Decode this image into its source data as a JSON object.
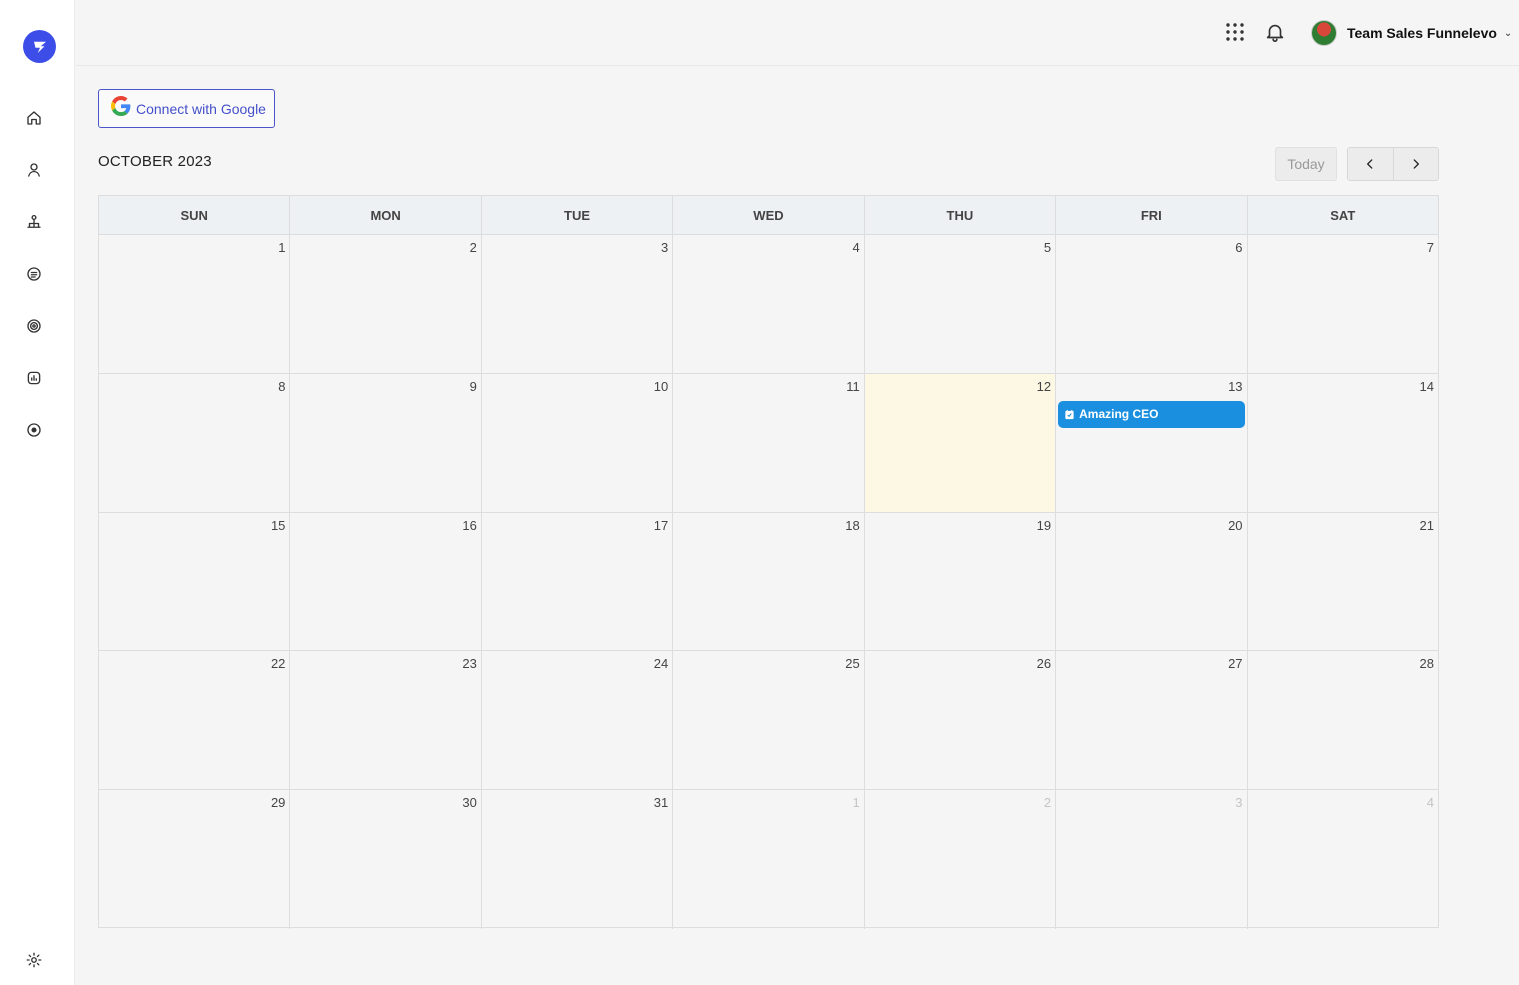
{
  "sidebar": {
    "items": [
      {
        "name": "home-icon"
      },
      {
        "name": "user-icon"
      },
      {
        "name": "org-chart-icon"
      },
      {
        "name": "document-icon"
      },
      {
        "name": "target-icon"
      },
      {
        "name": "report-chart-icon"
      },
      {
        "name": "play-circle-icon"
      }
    ],
    "settings_icon": "gear-icon"
  },
  "topbar": {
    "user_name": "Team Sales Funnelevo",
    "chevron": "⌄"
  },
  "connect": {
    "label": "Connect with Google"
  },
  "calendar": {
    "month_title": "OCTOBER 2023",
    "today_label": "Today",
    "weekdays": [
      "SUN",
      "MON",
      "TUE",
      "WED",
      "THU",
      "FRI",
      "SAT"
    ],
    "weeks": [
      [
        "1",
        "2",
        "3",
        "4",
        "5",
        "6",
        "7"
      ],
      [
        "8",
        "9",
        "10",
        "11",
        "12",
        "13",
        "14"
      ],
      [
        "15",
        "16",
        "17",
        "18",
        "19",
        "20",
        "21"
      ],
      [
        "22",
        "23",
        "24",
        "25",
        "26",
        "27",
        "28"
      ],
      [
        "29",
        "30",
        "31",
        "1",
        "2",
        "3",
        "4"
      ]
    ],
    "today_date": "12",
    "events": [
      {
        "date": "13",
        "title": "Amazing CEO",
        "color": "#1a8fe0"
      }
    ]
  },
  "colors": {
    "accent": "#3d4ee8",
    "event": "#1a8fe0",
    "today_bg": "#fcf8e3"
  }
}
